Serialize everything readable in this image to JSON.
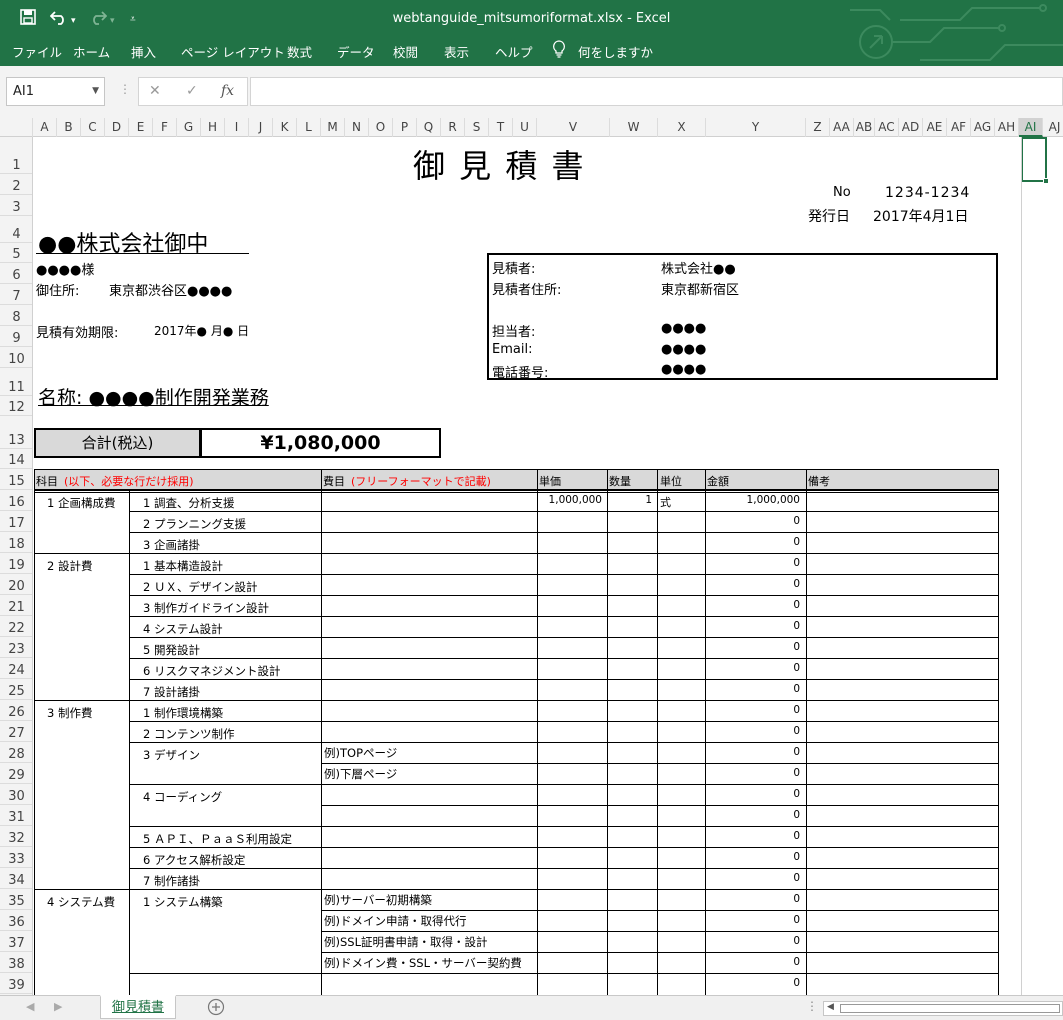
{
  "window": {
    "title": "webtanguide_mitsumoriformat.xlsx  -  Excel",
    "quick_access": {
      "save_icon": "floppy-disk-icon",
      "undo_icon": "undo-icon",
      "redo_icon": "redo-icon",
      "customize_icon": "customize-qat-icon"
    },
    "colors": {
      "accent": "#217346",
      "selected_cell": "#217346",
      "red_note": "#ff0000",
      "header_fill": "#d9d9d9"
    }
  },
  "ribbon": {
    "tabs": [
      "ファイル",
      "ホーム",
      "挿入",
      "ページ レイアウト",
      "数式",
      "データ",
      "校閲",
      "表示",
      "ヘルプ"
    ],
    "tell_me": "何をしますか",
    "tell_me_icon": "lightbulb-icon"
  },
  "formula_bar": {
    "name_box": "AI1",
    "cancel": "✕",
    "enter": "✓",
    "fx": "fx",
    "formula": ""
  },
  "columns": [
    "A",
    "B",
    "C",
    "D",
    "E",
    "F",
    "G",
    "H",
    "I",
    "J",
    "K",
    "L",
    "M",
    "N",
    "O",
    "P",
    "Q",
    "R",
    "S",
    "T",
    "U",
    "V",
    "W",
    "X",
    "Y",
    "Z",
    "AA",
    "AB",
    "AC",
    "AD",
    "AE",
    "AF",
    "AG",
    "AH",
    "AI",
    "AJ"
  ],
  "rows": [
    "1",
    "2",
    "3",
    "4",
    "5",
    "6",
    "7",
    "8",
    "9",
    "10",
    "11",
    "12",
    "13",
    "14",
    "15",
    "16",
    "17",
    "18",
    "19",
    "20",
    "21",
    "22",
    "23",
    "24",
    "25",
    "26",
    "27",
    "28",
    "29",
    "30",
    "31",
    "32",
    "33",
    "34",
    "35",
    "36",
    "37",
    "38",
    "39"
  ],
  "doc": {
    "title": "御 見 積 書",
    "no_label": "No",
    "no_value": "1234-1234",
    "date_label": "発行日",
    "date_value": "2017年4月1日",
    "client": "●●株式会社御中",
    "contact": "●●●●様",
    "address_label": "御住所:",
    "address": "東京都渋谷区●●●●",
    "validity_label": "見積有効期限:",
    "validity": "2017年● 月● 日",
    "issuer": {
      "estimator_label": "見積者:",
      "estimator": "株式会社●●",
      "address_label": "見積者住所:",
      "address": "東京都新宿区",
      "person_label": "担当者:",
      "person": "●●●●",
      "email_label": "Email:",
      "email": "●●●●",
      "phone_label": "電話番号:",
      "phone": "●●●●"
    },
    "project": "名称: ●●●●制作開発業務",
    "total_label": "合計(税込)",
    "total": "¥1,080,000"
  },
  "table": {
    "headers": {
      "category": "科目",
      "category_note": "(以下、必要な行だけ採用)",
      "expense": "費目",
      "expense_note": "(フリーフォーマットで記載)",
      "unit_price": "単価",
      "qty": "数量",
      "unit": "単位",
      "amount": "金額",
      "remarks": "備考"
    },
    "categories": [
      {
        "label": "1 企画構成費",
        "row": 16
      },
      {
        "label": "2 設計費",
        "row": 19
      },
      {
        "label": "3 制作費",
        "row": 26
      },
      {
        "label": "4 システム費",
        "row": 35
      }
    ],
    "items": [
      {
        "label": "1 調査、分析支援",
        "row": 16
      },
      {
        "label": "2 プランニング支援",
        "row": 17
      },
      {
        "label": "3 企画諸掛",
        "row": 18
      },
      {
        "label": "1 基本構造設計",
        "row": 19
      },
      {
        "label": "2 ＵＸ、デザイン設計",
        "row": 20
      },
      {
        "label": "3 制作ガイドライン設計",
        "row": 21
      },
      {
        "label": "4 システム設計",
        "row": 22
      },
      {
        "label": "5 開発設計",
        "row": 23
      },
      {
        "label": "6 リスクマネジメント設計",
        "row": 24
      },
      {
        "label": "7 設計諸掛",
        "row": 25
      },
      {
        "label": "1 制作環境構築",
        "row": 26
      },
      {
        "label": "2 コンテンツ制作",
        "row": 27
      },
      {
        "label": "3 デザイン",
        "row": 28
      },
      {
        "label": "4 コーディング",
        "row": 30
      },
      {
        "label": "5 ＡＰＩ、ＰａａＳ利用設定",
        "row": 32
      },
      {
        "label": "6 アクセス解析設定",
        "row": 33
      },
      {
        "label": "7 制作諸掛",
        "row": 34
      },
      {
        "label": "1 システム構築",
        "row": 35
      }
    ],
    "details": [
      {
        "label": "例)TOPページ",
        "row": 28
      },
      {
        "label": "例)下層ページ",
        "row": 29
      },
      {
        "label": "例)サーバー初期構築",
        "row": 35
      },
      {
        "label": "例)ドメイン申請・取得代行",
        "row": 36
      },
      {
        "label": "例)SSL証明書申請・取得・設計",
        "row": 37
      },
      {
        "label": "例)ドメイン費・SSL・サーバー契約費",
        "row": 38
      }
    ],
    "first_row": {
      "unit_price": "1,000,000",
      "qty": "1",
      "unit": "式",
      "amount": "1,000,000"
    },
    "zero_amount": "0"
  },
  "statusbar": {
    "sheet_tab": "御見積書",
    "add_sheet_icon": "plus-circle-icon"
  }
}
